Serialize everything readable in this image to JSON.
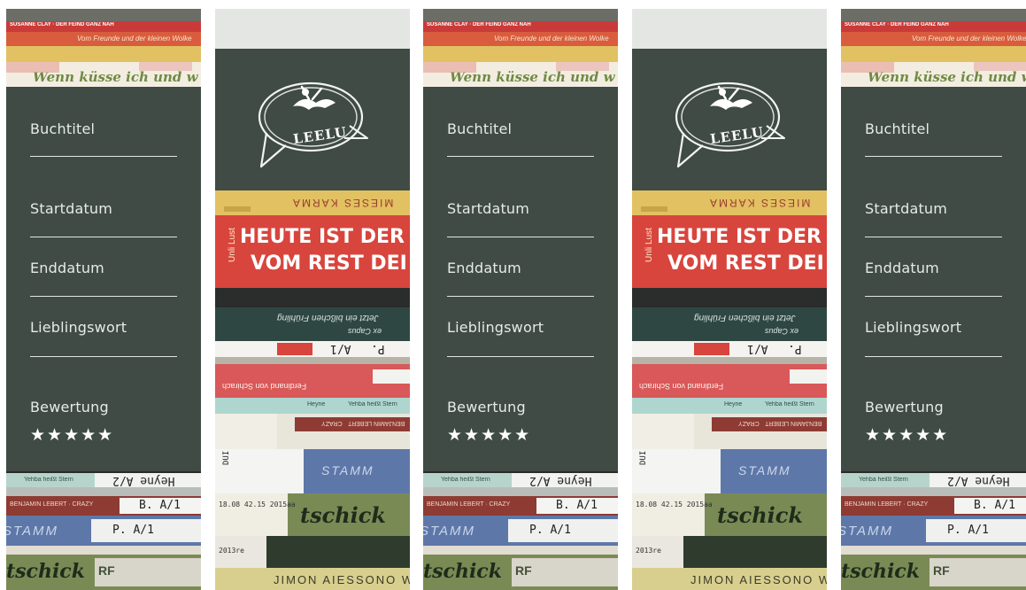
{
  "form": {
    "fields": [
      {
        "label": "Buchtitel"
      },
      {
        "label": "Startdatum"
      },
      {
        "label": "Enddatum"
      },
      {
        "label": "Lieblingswort"
      }
    ],
    "rating_label": "Bewertung",
    "stars": "★★★★★",
    "rating_value": 5,
    "rating_max": 5
  },
  "logo": {
    "text": "LEELU"
  },
  "spines": {
    "top": {
      "a": "SUSANNE CLAY · DER FEIND GANZ NAH",
      "b": "Vom Freunde und der kleinen Wolke",
      "c": "Wenn küsse ich und w"
    },
    "bottom": {
      "a": "Yehba heißt Stern",
      "b": "Heyne A/2",
      "c": "BENJAMIN LEBERT · CRAZY",
      "d": "B. A/1",
      "e": "STAMM",
      "f": "P. A/1",
      "g": "tschick",
      "h": "RF"
    },
    "stack": {
      "a": "MIESES KARMA",
      "b": "HEUTE IST DER",
      "c": "VOM REST DEI",
      "d": "Unli Lust",
      "e": "Jetzt ein bißchen Frühling",
      "f": "ex Capus",
      "g": "A/1",
      "h": "P.",
      "i": "Ferdinand von Schirach",
      "j": "Heyne",
      "k": "Yehba heißt Stern",
      "l": "CRAZY",
      "m": "BENJAMIN LEBERT",
      "n": "DUI 18.08 42.18 2013aw",
      "o": "STAMM",
      "p": "tschick",
      "q": "18.08 42.15 2015aa",
      "r": "2013re",
      "s": "JIMON AIESSONO W"
    }
  },
  "colors": {
    "panel": "#3f4b44",
    "text": "#e6ebe6",
    "divider": "#dfe6df",
    "red_book": "#d8453d",
    "yellow_book": "#e2c162"
  },
  "icons": {
    "logo": "speech-bubble-reading-figure-icon",
    "rating": "star-icon"
  }
}
